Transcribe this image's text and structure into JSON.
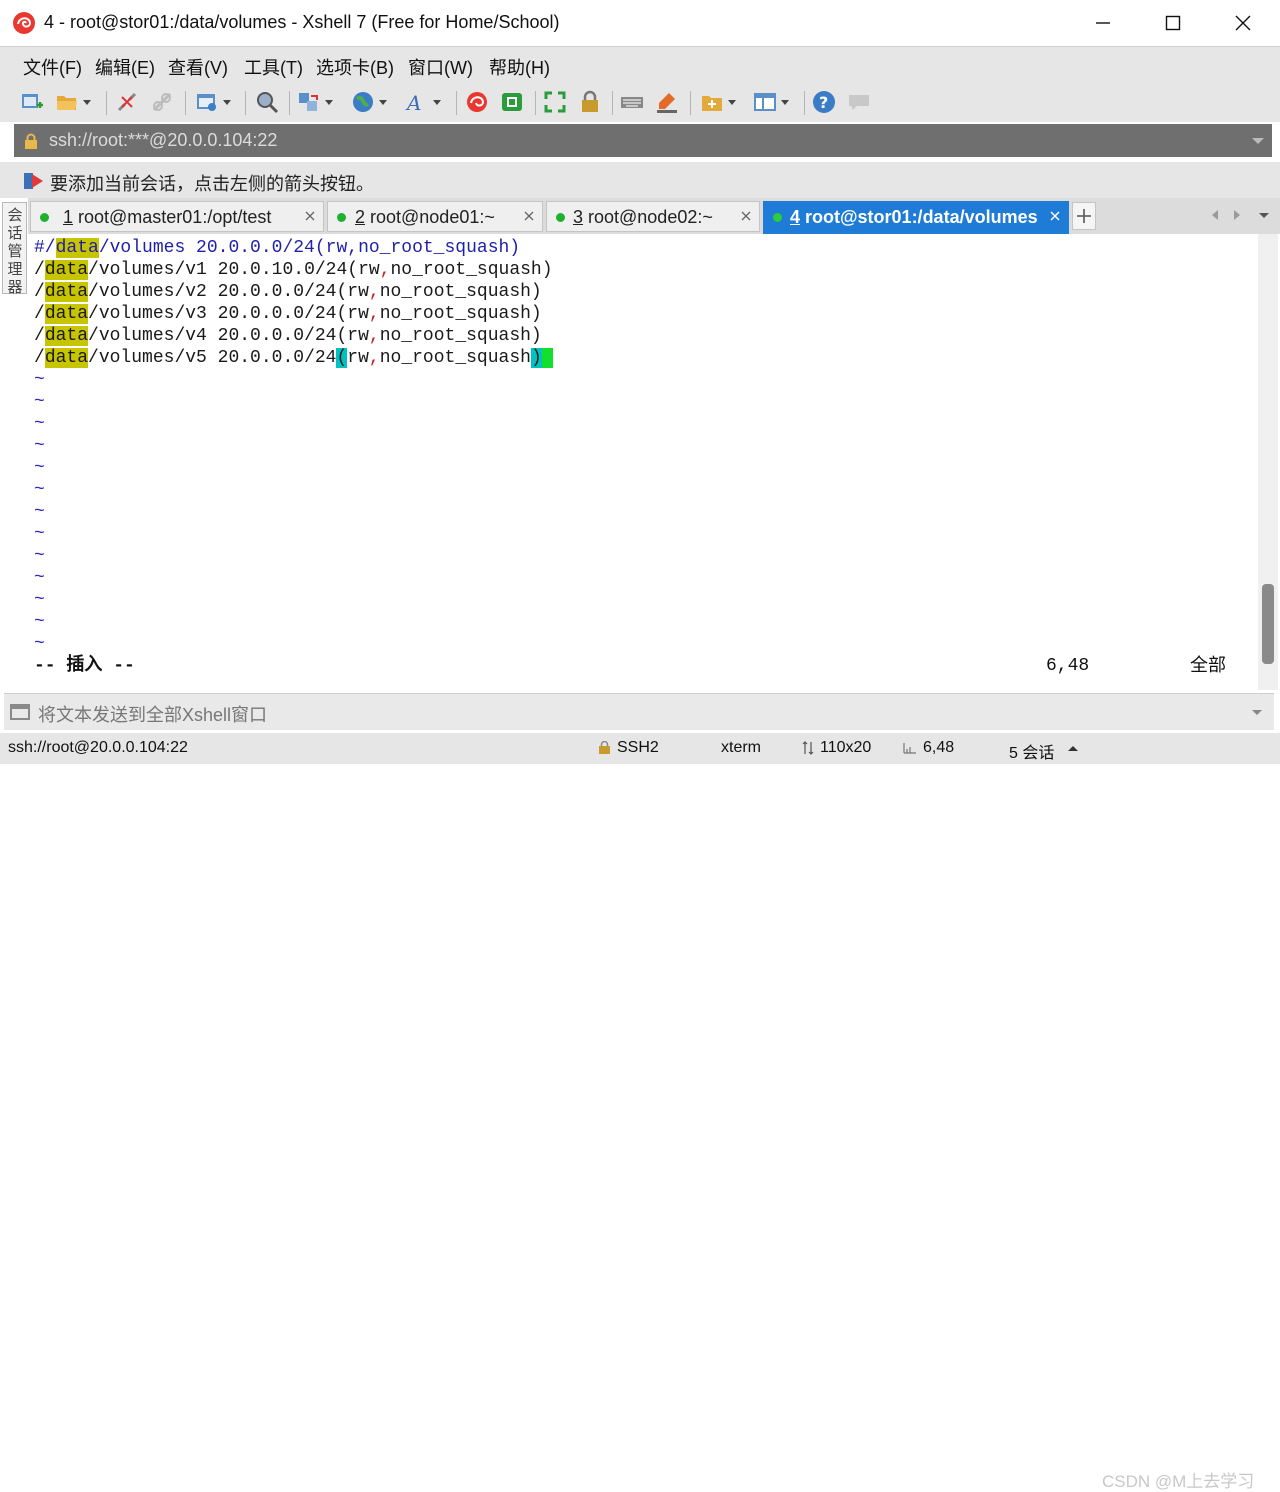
{
  "window": {
    "title": "4 - root@stor01:/data/volumes - Xshell 7 (Free for Home/School)"
  },
  "menu": [
    "文件(F)",
    "编辑(E)",
    "查看(V)",
    "工具(T)",
    "选项卡(B)",
    "窗口(W)",
    "帮助(H)"
  ],
  "address_bar": {
    "value": "ssh://root:***@20.0.0.104:22"
  },
  "hint": "要添加当前会话，点击左侧的箭头按钮。",
  "session_manager_label": "会话管理器",
  "tabs": [
    {
      "number": "1",
      "label": "root@master01:/opt/test",
      "active": false
    },
    {
      "number": "2",
      "label": "root@node01:~",
      "active": false
    },
    {
      "number": "3",
      "label": "root@node02:~",
      "active": false
    },
    {
      "number": "4",
      "label": "root@stor01:/data/volumes",
      "active": true
    }
  ],
  "terminal": {
    "line1": {
      "pre": "#/",
      "hl": "data",
      "post": "/volumes 20.0.0.0/24(rw,no_root_squash)"
    },
    "lines": [
      {
        "pre": "/",
        "hl": "data",
        "path": "/volumes/v1 20.0.10.0/24(rw",
        "comma": ",",
        "opt": "no_root_squash)"
      },
      {
        "pre": "/",
        "hl": "data",
        "path": "/volumes/v2 20.0.0.0/24(rw",
        "comma": ",",
        "opt": "no_root_squash)"
      },
      {
        "pre": "/",
        "hl": "data",
        "path": "/volumes/v3 20.0.0.0/24(rw",
        "comma": ",",
        "opt": "no_root_squash)"
      },
      {
        "pre": "/",
        "hl": "data",
        "path": "/volumes/v4 20.0.0.0/24(rw",
        "comma": ",",
        "opt": "no_root_squash)"
      }
    ],
    "line6": {
      "pre": "/",
      "hl": "data",
      "path": "/volumes/v5 20.0.0.0/24",
      "open": "(",
      "rw": "rw",
      "comma": ",",
      "opt": "no_root_squash",
      "close": ")"
    },
    "tilde": "~",
    "mode": "-- 插入 --",
    "position": "6,48",
    "scope": "全部"
  },
  "send_bar": {
    "placeholder": "将文本发送到全部Xshell窗口"
  },
  "statusbar": {
    "connection": "ssh://root@20.0.0.104:22",
    "protocol": "SSH2",
    "terminal_type": "xterm",
    "size": "110x20",
    "cursor": "6,48",
    "sessions": "5 会话"
  },
  "watermark": "CSDN @M上去学习",
  "colors": {
    "highlight": "#c7c400",
    "active_tab": "#1e7bd6",
    "tilde": "#2929c8",
    "cursor": "#12e02c",
    "bracket_match": "#00c2c2"
  }
}
